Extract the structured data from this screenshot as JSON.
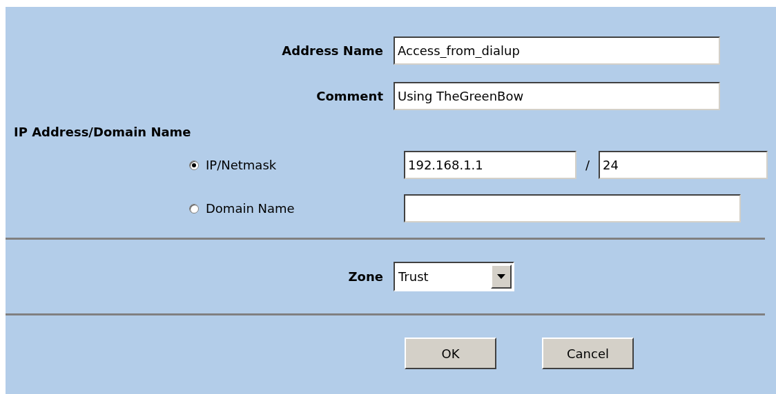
{
  "fields": [
    {
      "label": "Address Name",
      "value": "Access_from_dialup"
    },
    {
      "label": "Comment",
      "value": "Using TheGreenBow"
    }
  ],
  "section_heading": "IP Address/Domain Name",
  "address_options": [
    {
      "kind": "netmask",
      "label": "IP/Netmask",
      "selected": true,
      "address": "192.168.1.1",
      "separator": "/",
      "mask": "24"
    },
    {
      "kind": "domain",
      "label": "Domain Name",
      "selected": false
    }
  ],
  "zone": {
    "label": "Zone",
    "value": "Trust"
  },
  "buttons": [
    "OK",
    "Cancel"
  ]
}
